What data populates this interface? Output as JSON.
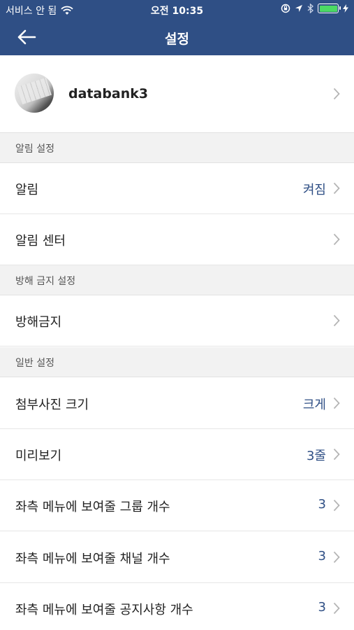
{
  "status_bar": {
    "carrier": "서비스 안 됨",
    "time": "오전 10:35"
  },
  "header": {
    "title": "설정"
  },
  "profile": {
    "username": "databank3"
  },
  "sections": {
    "notifications": {
      "title": "알림 설정",
      "items": [
        {
          "label": "알림",
          "value": "켜짐"
        },
        {
          "label": "알림 센터",
          "value": ""
        }
      ]
    },
    "dnd": {
      "title": "방해 금지 설정",
      "items": [
        {
          "label": "방해금지",
          "value": ""
        }
      ]
    },
    "general": {
      "title": "일반 설정",
      "items": [
        {
          "label": "첨부사진 크기",
          "value": "크게"
        },
        {
          "label": "미리보기",
          "value": "3줄"
        },
        {
          "label": "좌측 메뉴에 보여줄 그룹 개수",
          "value": "3"
        },
        {
          "label": "좌측 메뉴에 보여줄 채널 개수",
          "value": "3"
        },
        {
          "label": "좌측 메뉴에 보여줄 공지사항 개수",
          "value": "3"
        }
      ]
    }
  },
  "colors": {
    "header_bg": "#2f4f85",
    "accent_value": "#2f4f85",
    "battery": "#4cd964"
  },
  "icons": [
    "wifi-icon",
    "lock-rotation-icon",
    "location-arrow-icon",
    "bluetooth-icon",
    "battery-icon",
    "charging-icon",
    "back-arrow-icon",
    "chevron-right-icon"
  ]
}
